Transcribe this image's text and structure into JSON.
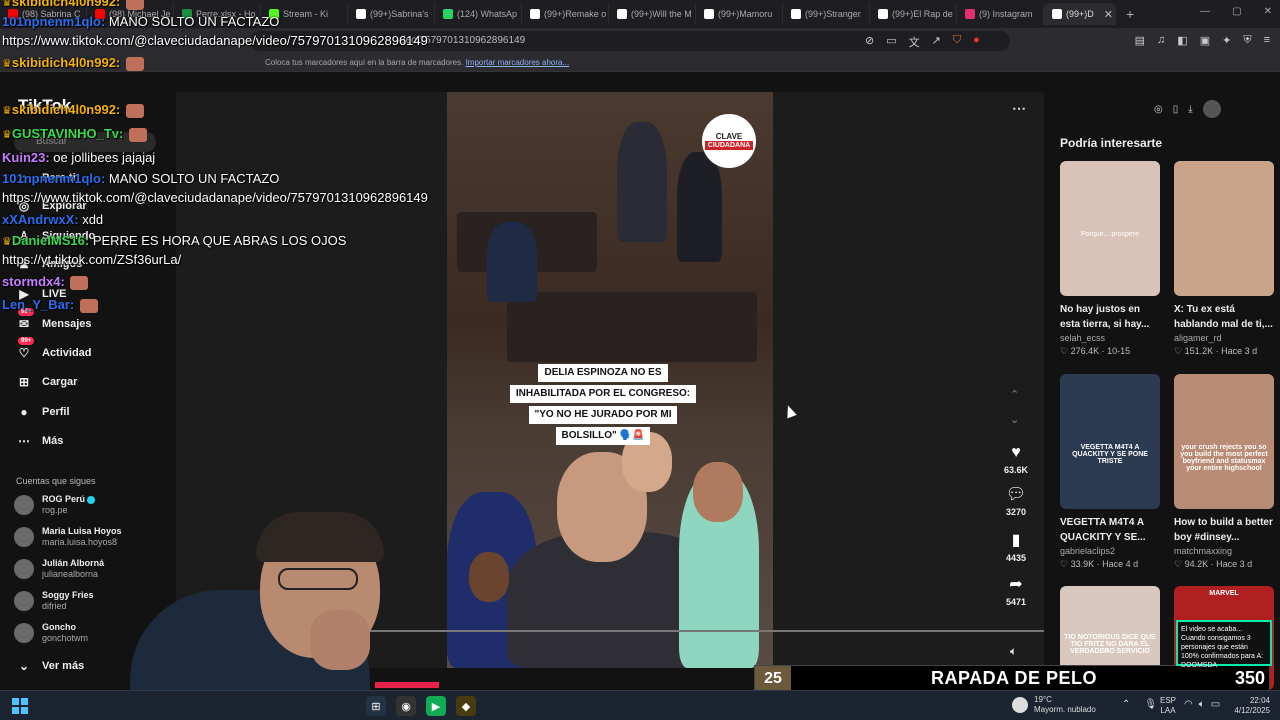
{
  "browser": {
    "tabs": [
      {
        "label": "(98) Sabrina C",
        "color": "#ff0000"
      },
      {
        "label": "(98) Michael Je",
        "color": "#ff0000"
      },
      {
        "label": "Perre.xlsx - Ho",
        "color": "#1e8e3e"
      },
      {
        "label": "Stream - Ki",
        "color": "#53fc18"
      },
      {
        "label": "(99+)Sabrina's",
        "color": "#ffffff"
      },
      {
        "label": "(124) WhatsAp",
        "color": "#25d366"
      },
      {
        "label": "(99+)Remake o",
        "color": "#ffffff"
      },
      {
        "label": "(99+)Will the M",
        "color": "#ffffff"
      },
      {
        "label": "(99+)Mamoru",
        "color": "#ffffff"
      },
      {
        "label": "(99+)Stranger",
        "color": "#ffffff"
      },
      {
        "label": "(99+)El Rap de",
        "color": "#ffffff"
      },
      {
        "label": "(9) Instagram",
        "color": "#e1306c"
      },
      {
        "label": "(99+)D",
        "color": "#ffffff",
        "active": true
      }
    ],
    "url": "https://www.tiktok.com/@claveciudadanape/video/7579701310962896149",
    "url_short": "deo/7579701310962896149",
    "bookmarks_text": "Coloca tus marcadores aquí en la barra de marcadores.",
    "bookmarks_link": "Importar marcadores ahora..."
  },
  "tiktok": {
    "logo": "TikTok",
    "search_placeholder": "Buscar",
    "nav": [
      {
        "label": "Para ti",
        "icon": "home-icon"
      },
      {
        "label": "Explorar",
        "icon": "compass-icon"
      },
      {
        "label": "Siguiendo",
        "icon": "following-icon"
      },
      {
        "label": "Amigos",
        "icon": "friends-icon"
      },
      {
        "label": "LIVE",
        "icon": "live-icon"
      },
      {
        "label": "Mensajes",
        "icon": "messages-icon",
        "badge": "99+"
      },
      {
        "label": "Actividad",
        "icon": "activity-icon",
        "badge": "99+"
      },
      {
        "label": "Cargar",
        "icon": "upload-icon"
      },
      {
        "label": "Perfil",
        "icon": "profile-icon"
      },
      {
        "label": "Más",
        "icon": "more-icon"
      }
    ],
    "following_title": "Cuentas que sigues",
    "following": [
      {
        "name": "ROG Perú",
        "handle": "rog.pe",
        "verified": true
      },
      {
        "name": "Maria Luisa Hoyos",
        "handle": "maria.luisa.hoyos8"
      },
      {
        "name": "Julián Alborná",
        "handle": "julianealborna"
      },
      {
        "name": "Soggy Fries",
        "handle": "difried"
      },
      {
        "name": "Goncho",
        "handle": "gonchotwm"
      }
    ],
    "see_more": "Ver más",
    "video": {
      "brand_top": "CLAVE",
      "brand_bottom": "CIUDADANA",
      "caption_lines": [
        "DELIA ESPINOZA NO ES",
        "INHABILITADA POR EL CONGRESO:",
        "\"YO NO HE JURADO POR MI",
        "BOLSILLO\" 🗣️🚨"
      ],
      "likes": "63.6K",
      "comments": "3270",
      "saves": "4435",
      "shares": "5471",
      "progress": 0.0
    },
    "recommend_title": "Podría interesarte",
    "recommendations": [
      {
        "title": "No hay justos en esta tierra, si hay...",
        "user": "selah_ecss",
        "likes": "276.4K",
        "date": "10-15",
        "thumb_color": "#d9c3b8",
        "overlay": "Porque... prospere"
      },
      {
        "title": "X: Tu ex está hablando mal de ti,...",
        "user": "aligamer_rd",
        "likes": "151.2K",
        "date": "Hace 3 d",
        "thumb_color": "#c9a48a",
        "overlay": ""
      },
      {
        "title": "VEGETTA M4T4 A QUACKITY Y SE...",
        "user": "gabrielaclips2",
        "likes": "33.9K",
        "date": "Hace 4 d",
        "thumb_color": "#2c3a52",
        "overlay": "VEGETTA M4T4 A QUACKITY Y SE PONE TRISTE"
      },
      {
        "title": "How to build a better boy #dinsey...",
        "user": "matchmaxxing",
        "likes": "94.2K",
        "date": "Hace 3 d",
        "thumb_color": "#b98a74",
        "overlay": "your crush rejects you so you build the most perfect boyfriend and statusmax your entire highschool"
      },
      {
        "title": "",
        "user": "",
        "likes": "",
        "date": "",
        "thumb_color": "#d8c8c0",
        "overlay": "TIO NOTORIOUS DICE QUE TIO FRITZ NO DARA EL VERDADERO SERVICIO"
      },
      {
        "title": "",
        "user": "",
        "likes": "",
        "date": "",
        "thumb_color": "#b02020",
        "overlay": "MARVEL"
      }
    ]
  },
  "chat": [
    {
      "user": "skibidich4l0n992:",
      "msg": "",
      "color": "#f4b400",
      "crown": true,
      "emote": true
    },
    {
      "user": "101npnenm1qlo:",
      "msg": "MANO SOLTO UN FACTAZO",
      "color": "#2a6ef0"
    },
    {
      "user": "",
      "msg": "https://www.tiktok.com/@claveciudadanape/video/7579701310962896149",
      "color": "#fff"
    },
    {
      "user": "skibidich4l0n992:",
      "msg": "",
      "color": "#f4b400",
      "crown": true,
      "emote": true
    },
    {
      "user": "skibidich4l0n992:",
      "msg": "",
      "color": "#f4b400",
      "crown": true,
      "emote": true
    },
    {
      "user": "GUSTAVINHO_Tv:",
      "msg": "",
      "color": "#3ad94f",
      "crown": true,
      "emote": true
    },
    {
      "user": "Kuin23:",
      "msg": "oe jollibees jajajaj",
      "color": "#c77dff"
    },
    {
      "user": "101npnenm1qlo:",
      "msg": "MANO SOLTO UN FACTAZO",
      "color": "#2a6ef0"
    },
    {
      "user": "",
      "msg": "https://www.tiktok.com/@claveciudadanape/video/7579701310962896149",
      "color": "#fff"
    },
    {
      "user": "xXAndrwxX:",
      "msg": "xdd",
      "color": "#2a6ef0"
    },
    {
      "user": "DanielMS16:",
      "msg": "PERRE ES HORA QUE ABRAS LOS OJOS",
      "color": "#3ad94f",
      "crown": true
    },
    {
      "user": "",
      "msg": "https://vt.tiktok.com/ZSf36urLa/",
      "color": "#fff"
    },
    {
      "user": "stormdx4:",
      "msg": "",
      "color": "#c77dff",
      "emote": true
    },
    {
      "user": "Len_Y_Bar:",
      "msg": "",
      "color": "#2a6ef0",
      "emote": true
    }
  ],
  "stream": {
    "number": "25",
    "label": "RAPADA DE PELO",
    "count": "350",
    "progress": 0.38,
    "popup": "El video se acaba... Cuando consigamos 3 personajes que están 100% confirmados para A: DOOMSDA"
  },
  "taskbar": {
    "weather_temp": "19°C",
    "weather_desc": "Mayorm. nublado",
    "lang_top": "ESP",
    "lang_bottom": "LAA",
    "time": "22:04",
    "date": "4/12/2025"
  }
}
